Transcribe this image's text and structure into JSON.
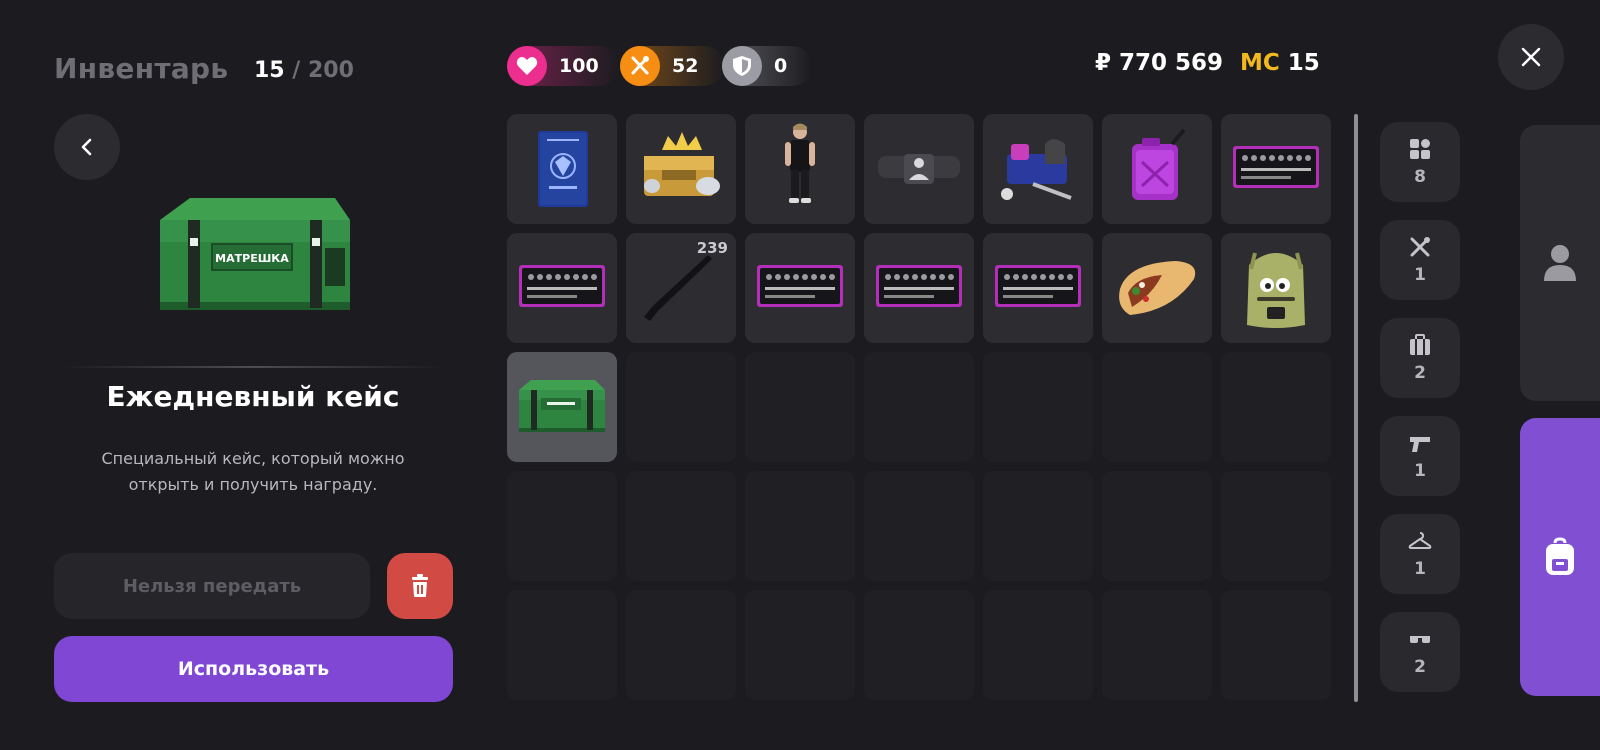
{
  "header": {
    "title": "Инвентарь",
    "count_current": "15",
    "count_separator": " / ",
    "count_max": "200"
  },
  "stats": {
    "health": "100",
    "food": "52",
    "armor": "0"
  },
  "currency": {
    "money": "₽ 770 569",
    "mc_label": "MC",
    "mc_value": "15"
  },
  "selected_item": {
    "name": "Ежедневный кейс",
    "description": "Специальный кейс, который можно открыть и получить награду.",
    "transfer_label": "Нельзя передать",
    "use_label": "Использовать",
    "box_label": "МАТРЕШКА"
  },
  "inventory": {
    "slots_visible": 35,
    "items": [
      {
        "slot": 1,
        "icon": "passport-icon",
        "name": "Паспорт"
      },
      {
        "slot": 2,
        "icon": "gold-chest-icon",
        "name": "Золотой сундук"
      },
      {
        "slot": 3,
        "icon": "character-skin-icon",
        "name": "Скин"
      },
      {
        "slot": 4,
        "icon": "pass-card-icon",
        "name": "Бейдж"
      },
      {
        "slot": 5,
        "icon": "repair-kit-icon",
        "name": "Ремкомплект"
      },
      {
        "slot": 6,
        "icon": "fuel-canister-icon",
        "name": "Канистра"
      },
      {
        "slot": 7,
        "icon": "tool-kit-icon",
        "name": "Набор инструментов"
      },
      {
        "slot": 8,
        "icon": "tool-kit-icon",
        "name": "Набор инструментов"
      },
      {
        "slot": 9,
        "icon": "rifle-icon",
        "name": "Винтовка",
        "quantity": "239"
      },
      {
        "slot": 10,
        "icon": "tool-kit-icon",
        "name": "Набор инструментов"
      },
      {
        "slot": 11,
        "icon": "tool-kit-icon",
        "name": "Набор инструментов"
      },
      {
        "slot": 12,
        "icon": "tool-kit-icon",
        "name": "Набор инструментов"
      },
      {
        "slot": 13,
        "icon": "shawarma-icon",
        "name": "Шаурма"
      },
      {
        "slot": 14,
        "icon": "backpack-icon",
        "name": "Рюкзак"
      },
      {
        "slot": 15,
        "icon": "daily-case-icon",
        "name": "Ежедневный кейс",
        "selected": true
      }
    ]
  },
  "categories": [
    {
      "icon": "grid-icon",
      "count": "8"
    },
    {
      "icon": "food-icon",
      "count": "1"
    },
    {
      "icon": "suitcase-icon",
      "count": "2"
    },
    {
      "icon": "pistol-icon",
      "count": "1"
    },
    {
      "icon": "hanger-icon",
      "count": "1"
    },
    {
      "icon": "glasses-icon",
      "count": "2"
    }
  ],
  "tabs": [
    {
      "icon": "person-icon",
      "active": false
    },
    {
      "icon": "backpack-tab-icon",
      "active": true
    }
  ],
  "colors": {
    "background": "#1c1c20",
    "accent": "#8046d4",
    "danger": "#d24a44",
    "health": "#ec2e8e",
    "food": "#f58e12",
    "mc_gold": "#f3b81e"
  }
}
